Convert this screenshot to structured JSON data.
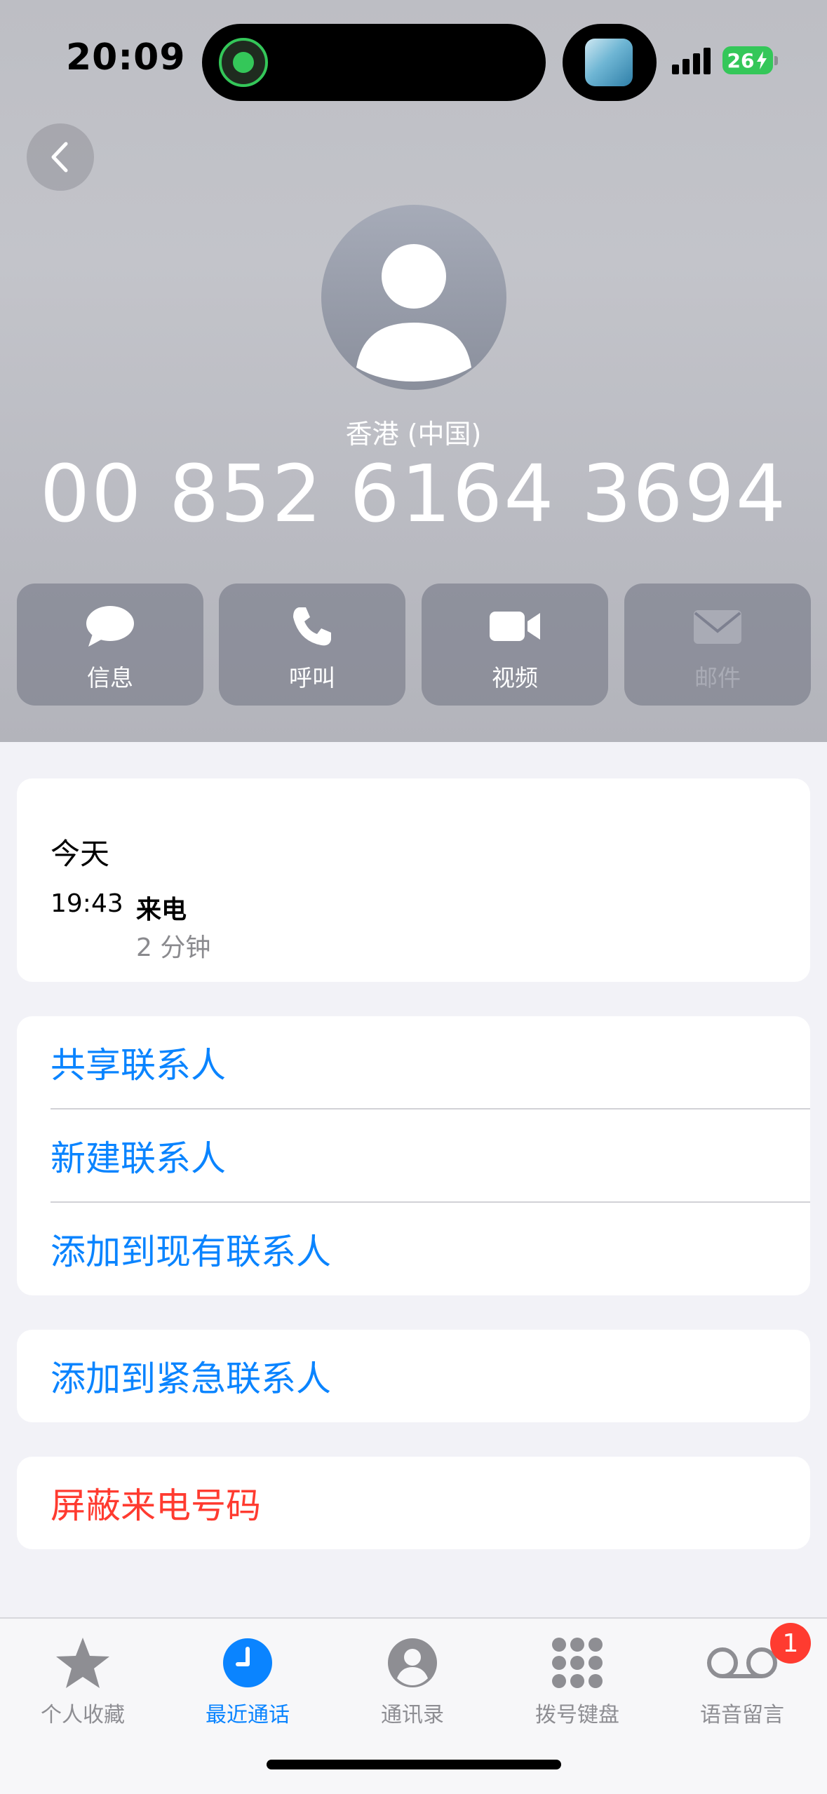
{
  "status_bar": {
    "time": "20:09",
    "battery": "26",
    "icons": [
      "live-activity-icon",
      "now-playing-thumbnail",
      "cellular-signal-icon",
      "charging-battery-icon"
    ]
  },
  "contact": {
    "region": "香港 (中国)",
    "phone": "00 852 6164 3694"
  },
  "actions": [
    {
      "label": "信息",
      "icon": "message-icon",
      "enabled": true
    },
    {
      "label": "呼叫",
      "icon": "phone-icon",
      "enabled": true
    },
    {
      "label": "视频",
      "icon": "video-icon",
      "enabled": true
    },
    {
      "label": "邮件",
      "icon": "mail-icon",
      "enabled": false
    }
  ],
  "call_history": {
    "day": "今天",
    "entries": [
      {
        "time": "19:43",
        "type": "来电",
        "duration": "2 分钟"
      }
    ]
  },
  "menu": {
    "contact_options": [
      "共享联系人",
      "新建联系人",
      "添加到现有联系人"
    ],
    "emergency": "添加到紧急联系人",
    "block": "屏蔽来电号码"
  },
  "tabs": [
    {
      "label": "个人收藏",
      "icon": "star-icon",
      "active": false
    },
    {
      "label": "最近通话",
      "icon": "clock-icon",
      "active": true
    },
    {
      "label": "通讯录",
      "icon": "person-circle-icon",
      "active": false
    },
    {
      "label": "拨号键盘",
      "icon": "keypad-icon",
      "active": false
    },
    {
      "label": "语音留言",
      "icon": "voicemail-icon",
      "active": false,
      "badge": "1"
    }
  ],
  "colors": {
    "accent": "#0a84ff",
    "destructive": "#ff3b30",
    "battery": "#34c759"
  }
}
